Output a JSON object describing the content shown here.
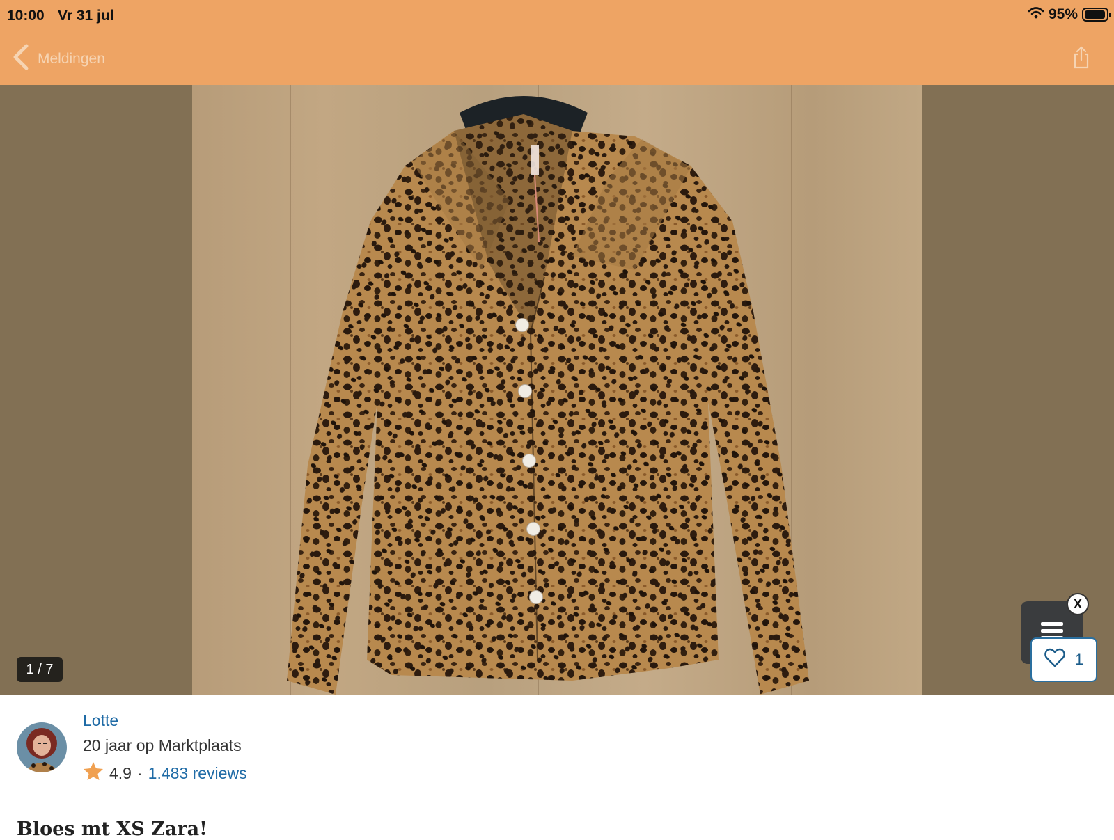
{
  "status_bar": {
    "time": "10:00",
    "date": "Vr 31 jul",
    "battery_percent": "95%",
    "battery_level": 0.95
  },
  "nav": {
    "back_label": "Meldingen"
  },
  "gallery": {
    "counter": "1 / 7",
    "favorites_count": "1",
    "menu_close": "X"
  },
  "seller": {
    "name": "Lotte",
    "member_since": "20 jaar op Marktplaats",
    "rating": "4.9",
    "separator": "·",
    "reviews": "1.483 reviews"
  },
  "listing": {
    "title": "Bloes    mt XS     Zara!"
  },
  "colors": {
    "brand_orange": "#eea464",
    "link_blue": "#1f6ba6",
    "star": "#f0a050"
  }
}
